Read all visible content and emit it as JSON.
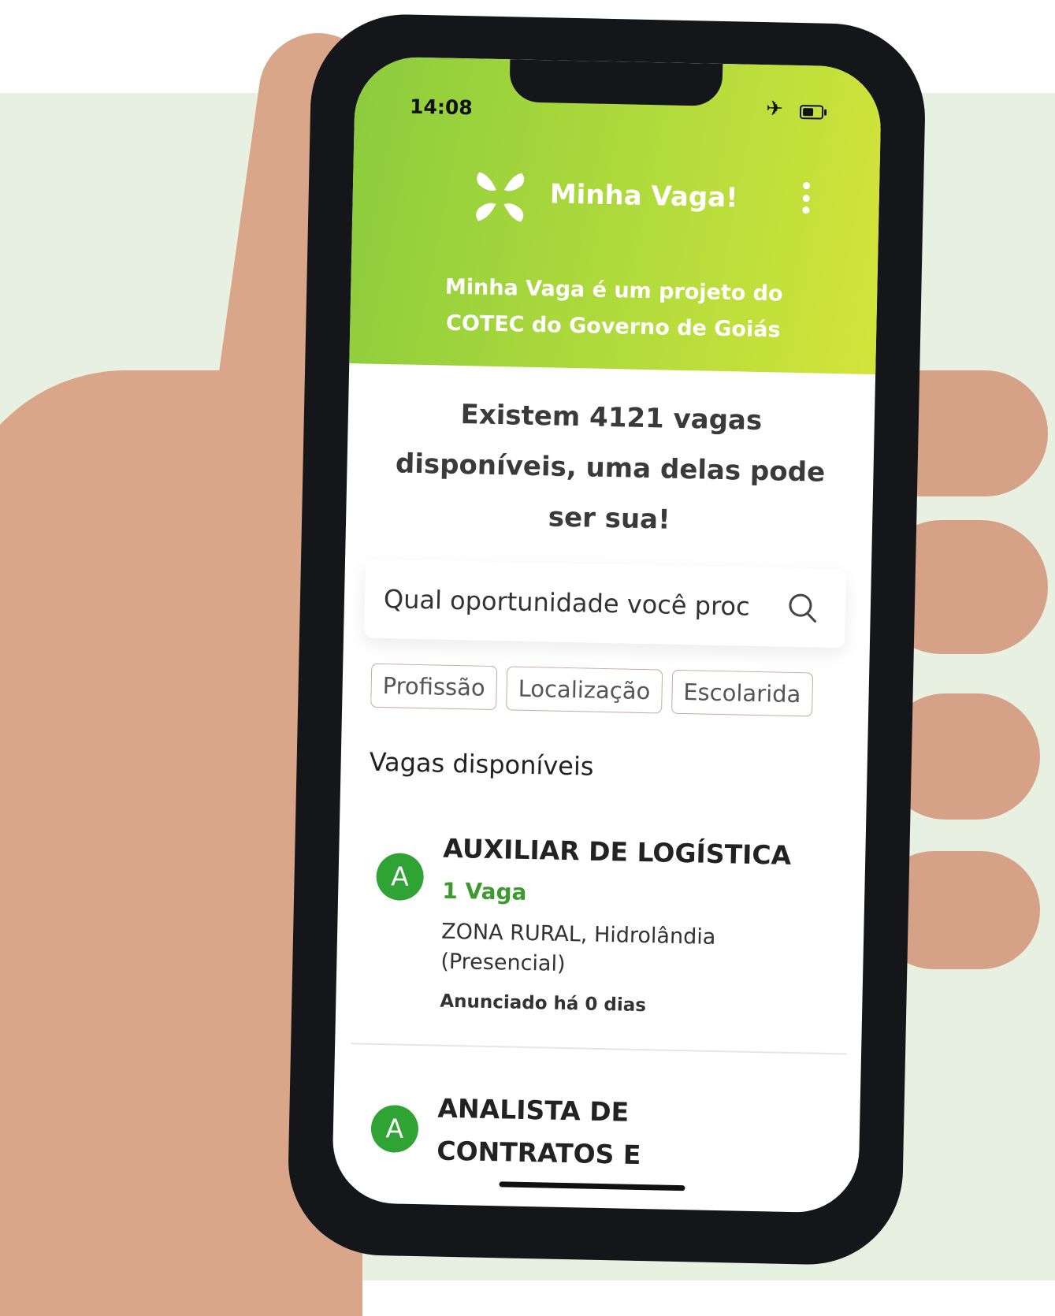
{
  "status_bar": {
    "time": "14:08",
    "airplane_icon": "airplane-icon",
    "battery_icon": "battery-icon",
    "battery_level_percent": 60
  },
  "header": {
    "app_title": "Minha Vaga!",
    "logo_icon": "x-logo-icon",
    "menu_icon": "kebab-menu-icon",
    "subtitle_line1": "Minha Vaga é um projeto do",
    "subtitle_line2": "COTEC do Governo de Goiás",
    "colors": {
      "gradient_start": "#8bcc3d",
      "gradient_end": "#d3e43a"
    }
  },
  "headline": {
    "line1": "Existem 4121 vagas",
    "line2": "disponíveis, uma delas pode",
    "line3": "ser sua!"
  },
  "search": {
    "placeholder": "Qual oportunidade você proc",
    "icon": "search-icon"
  },
  "filters": [
    "Profissão",
    "Localização",
    "Escolarida"
  ],
  "section": {
    "title": "Vagas disponíveis"
  },
  "jobs": [
    {
      "avatar": "A",
      "title": "AUXILIAR DE LOGÍSTICA",
      "vacancies": "1 Vaga",
      "location": "ZONA RURAL, Hidrolândia (Presencial)",
      "posted": "Anunciado há 0 dias"
    },
    {
      "avatar": "A",
      "title_line1": "ANALISTA DE",
      "title_line2": "CONTRATOS E"
    }
  ],
  "colors": {
    "accent_green": "#2fa334",
    "vacancy_green": "#3d9a2f",
    "background": "#e7f0e1"
  }
}
